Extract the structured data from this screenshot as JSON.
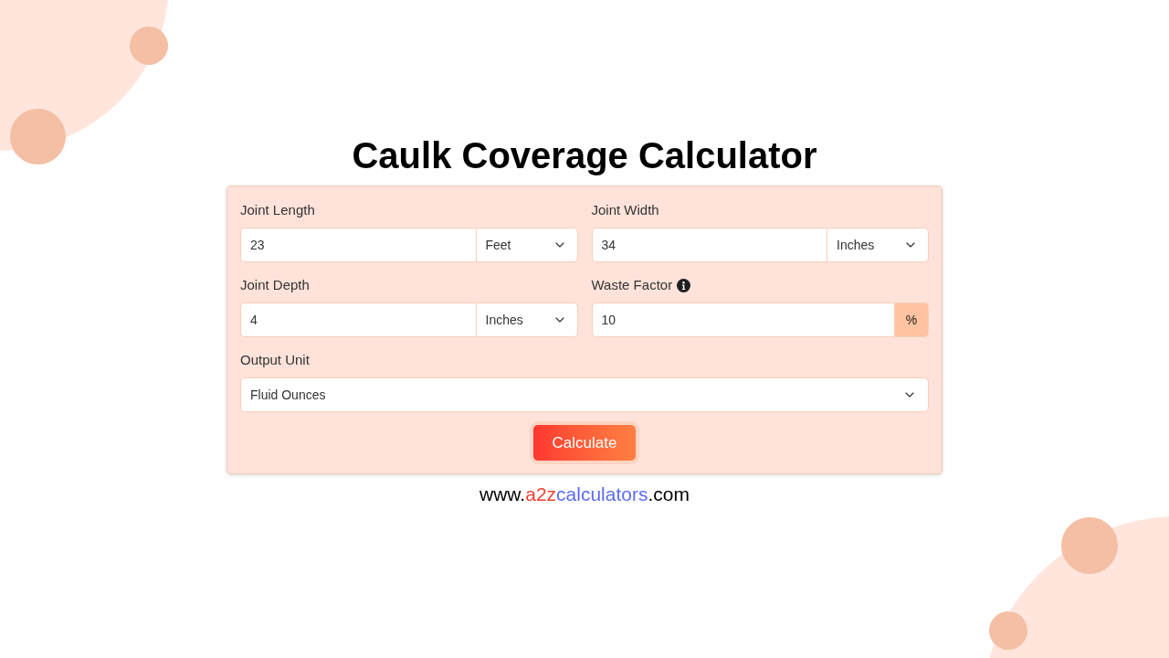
{
  "title": "Caulk Coverage Calculator",
  "fields": [
    {
      "label": "Joint Length",
      "kind": "number_unit",
      "info": false,
      "value": "23",
      "unit": "Feet"
    },
    {
      "label": "Joint Width",
      "kind": "number_unit",
      "info": false,
      "value": "34",
      "unit": "Inches"
    },
    {
      "label": "Joint Depth",
      "kind": "number_unit",
      "info": false,
      "value": "4",
      "unit": "Inches"
    },
    {
      "label": "Waste Factor",
      "kind": "number_suffix",
      "info": true,
      "value": "10",
      "suffix": "%"
    },
    {
      "label": "Output Unit",
      "kind": "select",
      "info": false,
      "value": "Fluid Ounces"
    }
  ],
  "button": {
    "label": "Calculate"
  },
  "footer": {
    "segments": [
      {
        "text": "www.",
        "color": "#000000"
      },
      {
        "text": "a2z",
        "color": "#f0402f"
      },
      {
        "text": "calculators",
        "color": "#5b6cf2"
      },
      {
        "text": ".com",
        "color": "#000000"
      }
    ]
  }
}
